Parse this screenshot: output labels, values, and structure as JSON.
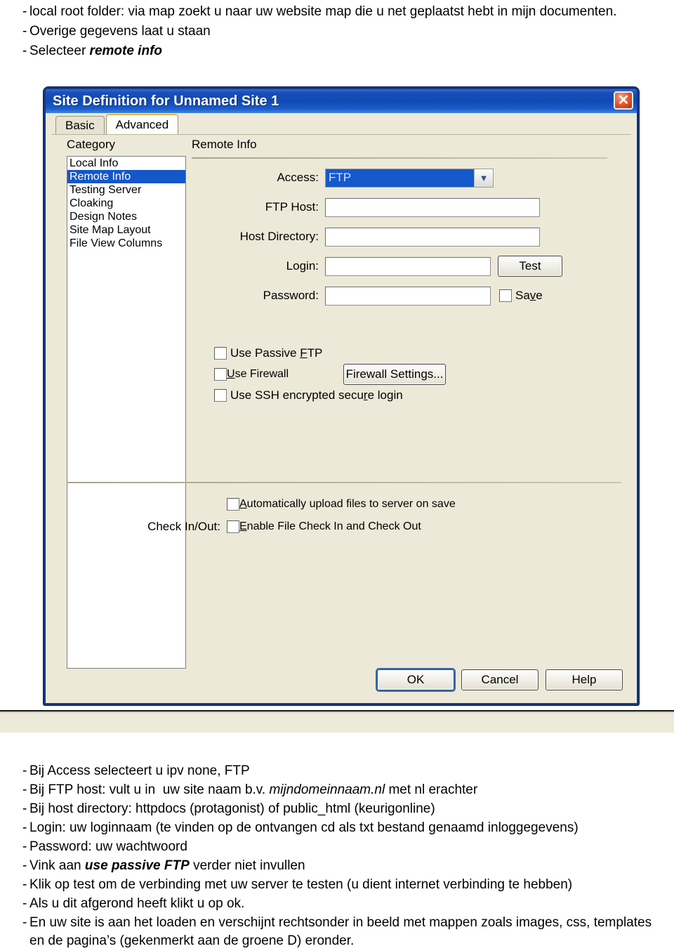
{
  "top_notes": [
    {
      "dash": "-",
      "html_parts": [
        {
          "t": "local root folder: via map zoekt u naar uw website map die u net geplaatst hebt in mijn documenten.",
          "style": "normal"
        }
      ]
    },
    {
      "dash": "-",
      "html_parts": [
        {
          "t": "Overige gegevens laat u staan",
          "style": "normal"
        }
      ]
    },
    {
      "dash": "-",
      "html_parts": [
        {
          "t": "Selecteer ",
          "style": "normal"
        },
        {
          "t": "remote info",
          "style": "bold-italic"
        }
      ]
    }
  ],
  "top_notes_plain": [
    "local root folder: via map zoekt u naar uw website map die u net geplaatst hebt in mijn documenten.",
    "Overige gegevens laat u staan",
    "Selecteer remote info"
  ],
  "dialog": {
    "title": "Site Definition for Unnamed Site 1",
    "close_icon": "close-icon",
    "tabs": [
      {
        "label": "Basic",
        "active": false
      },
      {
        "label": "Advanced",
        "active": true
      }
    ],
    "category": {
      "heading": "Category",
      "items": [
        {
          "label": "Local Info",
          "selected": false
        },
        {
          "label": "Remote Info",
          "selected": true
        },
        {
          "label": "Testing Server",
          "selected": false
        },
        {
          "label": "Cloaking",
          "selected": false
        },
        {
          "label": "Design Notes",
          "selected": false
        },
        {
          "label": "Site Map Layout",
          "selected": false
        },
        {
          "label": "File View Columns",
          "selected": false
        }
      ]
    },
    "remote_info": {
      "heading": "Remote Info",
      "access": {
        "label": "Access:",
        "value": "FTP",
        "arrow_icon": "chevron-down-icon"
      },
      "ftp_host": {
        "label": "FTP Host:",
        "value": ""
      },
      "host_directory": {
        "label": "Host Directory:",
        "value": ""
      },
      "login": {
        "label": "Login:",
        "value": ""
      },
      "password": {
        "label": "Password:",
        "value": ""
      },
      "test_button": "Test",
      "save_checkbox": {
        "label_pre": "Sa",
        "label_key": "v",
        "label_post": "e",
        "checked": false
      },
      "checkboxes": [
        {
          "pre": "Use Passive ",
          "key": "F",
          "post": "TP",
          "checked": false
        },
        {
          "pre": "",
          "key": "U",
          "post": "se Firewall",
          "checked": false
        },
        {
          "pre": "Use SSH encrypted secu",
          "key": "r",
          "post": "e login",
          "checked": false
        }
      ],
      "firewall_button": "Firewall Settings...",
      "auto_upload": {
        "pre": "",
        "key": "A",
        "post": "utomatically upload files to server on save",
        "checked": false
      },
      "check_in_out": {
        "label": "Check In/Out:",
        "pre": "",
        "key": "E",
        "post": "nable File Check In and Check Out",
        "checked": false
      }
    },
    "footer_buttons": [
      {
        "label": "OK",
        "default": true
      },
      {
        "label": "Cancel",
        "default": false
      },
      {
        "label": "Help",
        "default": false
      }
    ]
  },
  "bottom_notes": [
    "Bij Access selecteert u ipv none,  FTP",
    "Bij FTP host: vult u in  uw site naam b.v. mijndomeinnaam.nl met nl erachter",
    "Bij host directory: httpdocs (protagonist) of public_html (keurigonline)",
    "Login: uw loginnaam (te vinden op de ontvangen cd als txt bestand genaamd inloggegevens)",
    "Password: uw wachtwoord",
    "Vink aan use passive FTP verder niet invullen",
    "Klik op test om de verbinding met uw server te testen (u dient internet verbinding te hebben)",
    "Als u dit afgerond heeft klikt u op ok.",
    "En uw site is aan het loaden en verschijnt rechtsonder in beeld met mappen zoals images, css, templates en de pagina’s (gekenmerkt aan de groene D) eronder."
  ],
  "colors": {
    "titlebar_blue": "#1048b4",
    "selection_blue": "#1457c8",
    "dialog_face": "#ece9d8",
    "dialog_border": "#14387f",
    "close_red": "#e0522a",
    "band_beige": "#ecead8"
  }
}
